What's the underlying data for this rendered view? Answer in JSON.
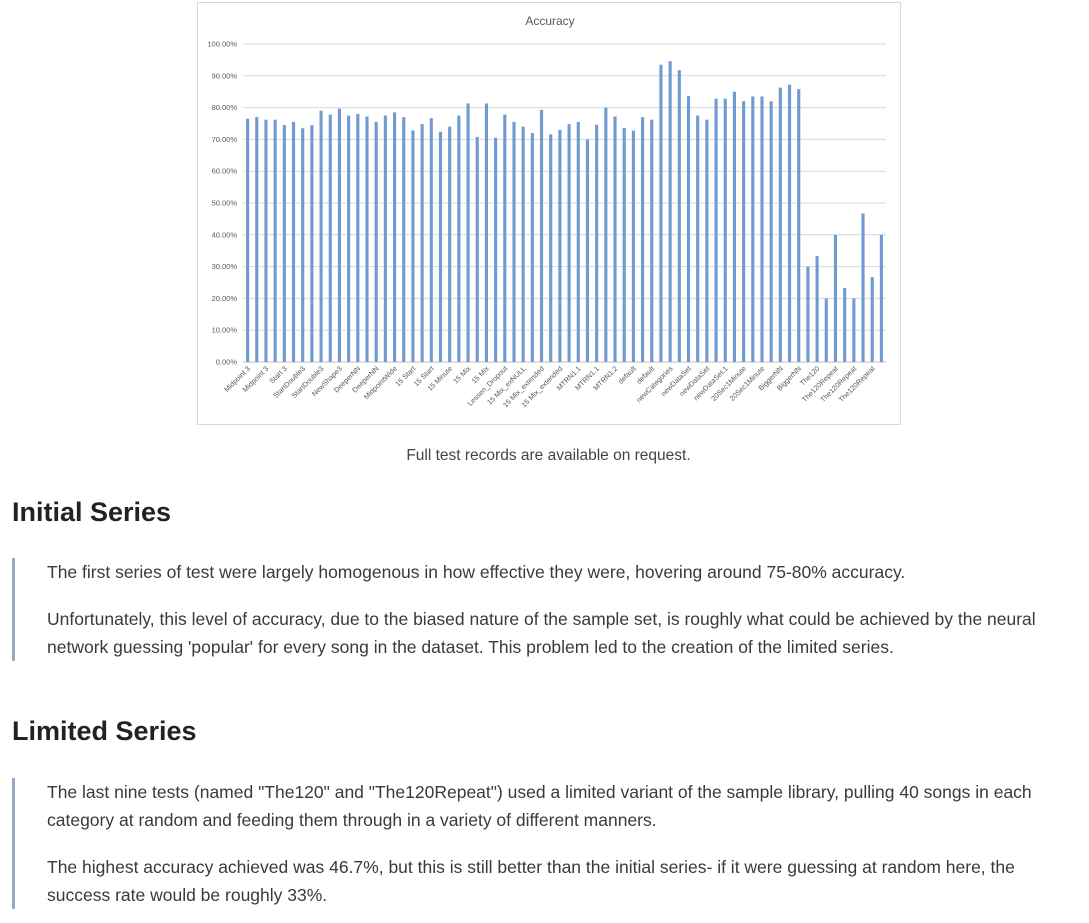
{
  "chart_data": {
    "type": "bar",
    "title": "Accuracy",
    "xlabel": "",
    "ylabel": "",
    "ylim": [
      0,
      100
    ],
    "yticks": [
      "0.00%",
      "10.00%",
      "20.00%",
      "30.00%",
      "40.00%",
      "50.00%",
      "60.00%",
      "70.00%",
      "80.00%",
      "90.00%",
      "100.00%"
    ],
    "grid": true,
    "bar_color": "#6f9bd1",
    "categories": [
      "Midpoint 3",
      "",
      "Midpoint 3",
      "",
      "Start 3",
      "",
      "StartDouble3",
      "",
      "StartDouble3",
      "",
      "NewShape3",
      "",
      "DeeperNN",
      "",
      "DeeperNN",
      "",
      "MidpointWide",
      "",
      "15 Start",
      "",
      "15 Start",
      "",
      "15 Minute",
      "",
      "15 Mix",
      "",
      "15 Mix",
      "",
      "Lessen_Dropout",
      "",
      "15 Mix_exNULL",
      "",
      "15 Mix_extended",
      "",
      "15 Mix_extended",
      "",
      "MTRN1.1",
      "",
      "MTRN1.1",
      "",
      "MTRN1.2",
      "",
      "default",
      "",
      "default",
      "",
      "newCategories",
      "",
      "newDataSet",
      "",
      "newDataSet",
      "",
      "newDataSet.1",
      "",
      "20Sec1Minute",
      "",
      "20Sec1Minute",
      "",
      "BiggerNN",
      "",
      "BiggerNN",
      "",
      "The120",
      "",
      "The120Repeat",
      "",
      "The120Repeat",
      "",
      "The120Repeat",
      ""
    ],
    "values": [
      76.5,
      77.0,
      76.2,
      76.2,
      74.5,
      75.5,
      73.5,
      74.5,
      79.0,
      77.8,
      79.7,
      77.5,
      78.0,
      77.2,
      75.5,
      77.5,
      78.5,
      77.0,
      72.8,
      74.8,
      76.7,
      72.4,
      74.0,
      77.5,
      81.3,
      70.8,
      81.3,
      70.5,
      77.8,
      75.5,
      74.0,
      72.0,
      79.3,
      71.6,
      73.0,
      74.8,
      75.5,
      70.0,
      74.6,
      80.0,
      77.2,
      73.6,
      72.8,
      77.0,
      76.2,
      93.5,
      94.6,
      91.8,
      83.6,
      77.5,
      76.2,
      82.8,
      82.8,
      85.0,
      82.0,
      83.5,
      83.5,
      82.0,
      86.3,
      87.2,
      85.8,
      30.0,
      33.3,
      20.0,
      40.0,
      23.3,
      20.0,
      46.7,
      26.7,
      40.0
    ]
  },
  "caption": "Full test records are available on request.",
  "sections": [
    {
      "heading": "Initial Series",
      "paragraphs": [
        "The first series of test were largely homogenous in how effective they were, hovering around 75-80% accuracy.",
        "Unfortunately, this level of accuracy, due to the biased nature of the sample set, is roughly what could be achieved by the neural network guessing 'popular' for every song in the dataset. This problem led to the creation of the limited series."
      ]
    },
    {
      "heading": "Limited Series",
      "paragraphs": [
        "The last nine tests (named \"The120\" and \"The120Repeat\") used a limited variant of the sample library, pulling 40 songs in each category at random and feeding them through in a variety of different manners.",
        "The highest accuracy achieved was 46.7%, but this is still better than the initial series- if it were guessing at random here, the success rate would be roughly 33%."
      ]
    }
  ]
}
